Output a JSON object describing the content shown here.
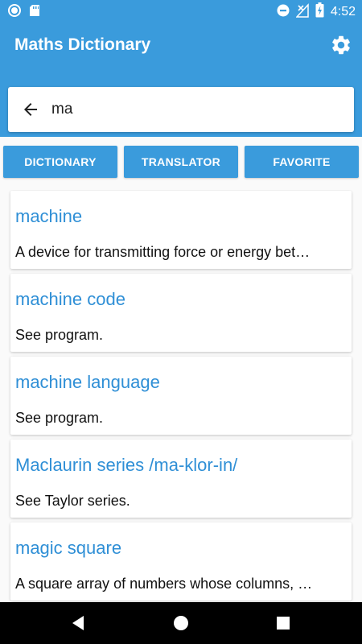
{
  "status_bar": {
    "time": "4:52",
    "icons": [
      "circle-notification-icon",
      "sd-card-icon",
      "do-not-disturb-icon",
      "signal-off-icon",
      "battery-charging-icon"
    ]
  },
  "app_bar": {
    "title": "Maths Dictionary",
    "settings_icon": "gear-icon"
  },
  "search": {
    "value": "ma",
    "back_icon": "arrow-left-icon"
  },
  "tabs": [
    {
      "label": "DICTIONARY"
    },
    {
      "label": "TRANSLATOR"
    },
    {
      "label": "FAVORITE"
    }
  ],
  "results": [
    {
      "term": "machine",
      "definition": "A device for transmitting force or energy bet…"
    },
    {
      "term": "machine code",
      "definition": "See program."
    },
    {
      "term": "machine language",
      "definition": "See program."
    },
    {
      "term": "Maclaurin series /ma-klor-in/",
      "definition": "See Taylor series."
    },
    {
      "term": "magic square",
      "definition": "A square array of numbers whose columns, …"
    }
  ],
  "nav_bar": {
    "icons": [
      "back-triangle-icon",
      "home-circle-icon",
      "recents-square-icon"
    ]
  },
  "colors": {
    "primary": "#3a9bdc",
    "term_text": "#2f8fd6",
    "nav_bar": "#000000"
  }
}
